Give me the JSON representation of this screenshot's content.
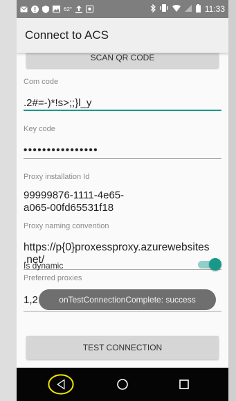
{
  "status_bar": {
    "time": "11:33",
    "temperature": "62°",
    "left_icons": [
      "mail-icon",
      "alert-icon",
      "shield-icon",
      "image-icon",
      "temperature-icon",
      "upload-icon",
      "photo-icon"
    ],
    "right_icons": [
      "bluetooth-icon",
      "vibrate-icon",
      "wifi-icon",
      "signal-icon",
      "battery-icon"
    ]
  },
  "app_bar": {
    "title": "Connect to ACS"
  },
  "buttons": {
    "scan_qr": "SCAN QR CODE",
    "test_connection": "TEST CONNECTION"
  },
  "form": {
    "com_code": {
      "label": "Com code",
      "value": ".2#=-)*!s>;;}l_y"
    },
    "key_code": {
      "label": "Key code",
      "value": "••••••••••••••••"
    },
    "proxy_installation_id": {
      "label": "Proxy installation Id",
      "value_line1": "99999876-1111-4e65-",
      "value_line2": "a065-00fd65531f18"
    },
    "proxy_naming_convention": {
      "label": "Proxy naming convention",
      "value_line1": "https://p{0}proxessproxy.azurewebsites",
      "value_line2": ".net/"
    },
    "is_dynamic": {
      "label": "Is dynamic",
      "checked": true
    },
    "preferred_proxies": {
      "label": "Preferred proxies",
      "value": "1,2"
    }
  },
  "toast": {
    "text": "onTestConnectionComplete: success"
  },
  "nav_bar": {
    "buttons": [
      "back-icon",
      "home-icon",
      "recents-icon"
    ]
  },
  "colors": {
    "accent": "#17998a",
    "status_bar": "#7e7e7e",
    "nav_bar": "#050505",
    "highlight_circle": "#f2e600"
  }
}
